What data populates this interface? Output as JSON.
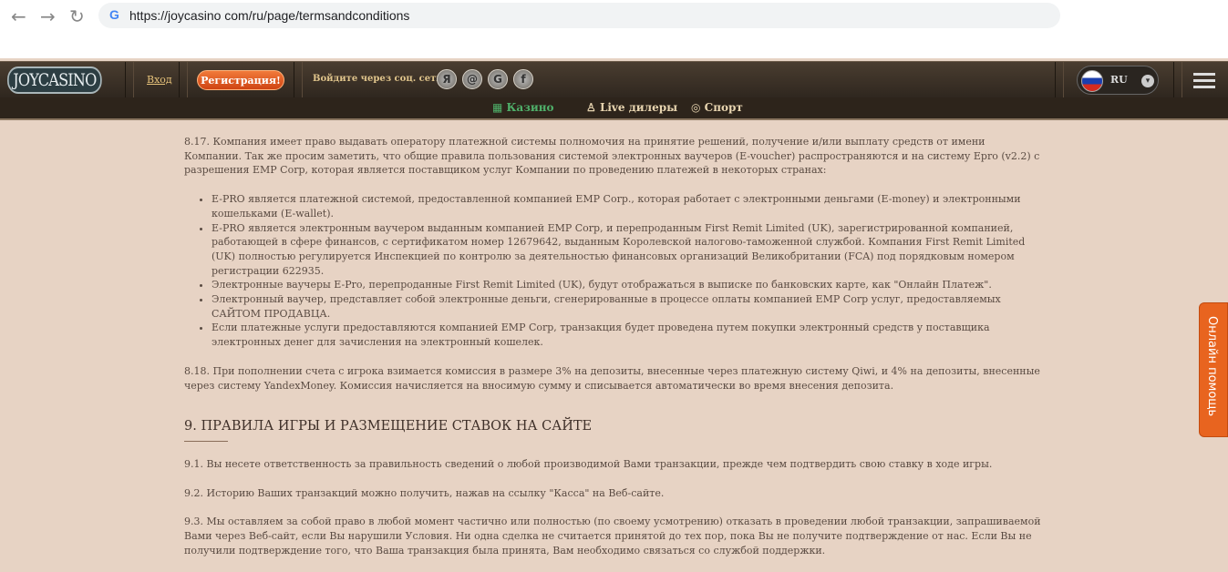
{
  "browser": {
    "url": "https://joycasino com/ru/page/termsandconditions"
  },
  "header": {
    "logo": "JOYCASINO",
    "login": "Вход",
    "register": "Регистрация!",
    "social_label": "Войдите через соц. сети:",
    "social": [
      "Я",
      "@",
      "G",
      "f"
    ],
    "language": "RU"
  },
  "tabs": [
    {
      "label": "Казино"
    },
    {
      "label": "Live дилеры"
    },
    {
      "label": "Спорт"
    }
  ],
  "content": {
    "p817": "8.17. Компания имеет право выдавать оператору платежной системы полномочия на принятие решений, получение и/или выплату средств от имени Компании. Так же просим заметить, что общие правила пользования системой электронных ваучеров (E-voucher) распространяются и на систему Epro (v2.2) с разрешения EMP Corp, которая является поставщиком услуг Компании по проведению платежей в некоторых странах:",
    "bullets": [
      "E-PRO является платежной системой, предоставленной компанией EMP Corp., которая работает с электронными деньгами (E-money) и электронными кошельками (E-wallet).",
      "E-PRO является электронным ваучером выданным компанией EMP Corp, и перепроданным First Remit Limited (UK), зарегистрированной компанией, работающей в сфере финансов, с сертификатом номер 12679642, выданным Королевской налогово-таможенной службой. Компания First Remit Limited (UK) полностью регулируется Инспекцией по контролю за деятельностью финансовых организаций Великобритании (FCA) под порядковым номером регистрации 622935.",
      "Электронные ваучеры E-Pro, перепроданные First Remit Limited (UK), будут отображаться в выписке по банковских карте, как \"Онлайн Платеж\".",
      "Электронный ваучер, представляет собой электронные деньги, сгенерированные в процессе оплаты компанией EMP Corp услуг, предоставляемых САЙТОМ ПРОДАВЦА.",
      "Если платежные услуги предоставляются компанией EMP Corp, транзакция будет проведена путем покупки электронный средств у поставщика электронных денег для зачисления на электронный кошелек."
    ],
    "p818": "8.18. При пополнении счета с игрока взимается комиссия в размере 3% на депозиты, внесенные через платежную систему Qiwi, и 4% на депозиты, внесенные через систему YandexMoney. Комиссия начисляется на вносимую сумму и списывается автоматически во время внесения депозита.",
    "h9": "9. ПРАВИЛА ИГРЫ И РАЗМЕЩЕНИЕ СТАВОК НА САЙТЕ",
    "p91": "9.1. Вы несете ответственность за правильность сведений о любой производимой Вами транзакции, прежде чем подтвердить свою ставку в ходе игры.",
    "p92": "9.2. Историю Ваших транзакций можно получить, нажав на ссылку \"Касса\" на Веб-сайте.",
    "p93": "9.3. Мы оставляем за собой право в любой момент частично или полностью (по своему усмотрению) отказать в проведении любой транзакции, запрашиваемой Вами через Веб-сайт, если Вы нарушили Условия. Ни одна сделка не считается принятой до тех пор, пока Вы не получите подтверждение от нас. Если Вы не получили подтверждение того, что Ваша транзакция была принята, Вам необходимо связаться со службой поддержки."
  },
  "help": "Онлайн помощь"
}
